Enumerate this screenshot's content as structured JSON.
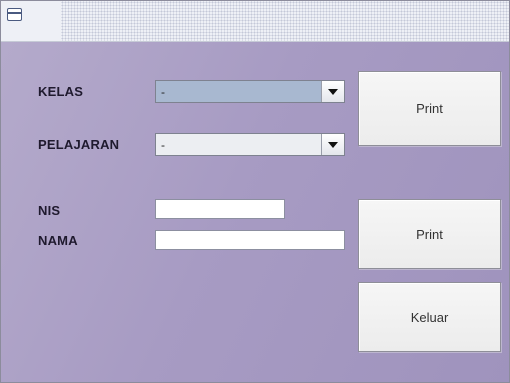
{
  "window": {
    "title": ""
  },
  "form": {
    "kelas_label": "KELAS",
    "kelas_value": "-",
    "pelajaran_label": "PELAJARAN",
    "pelajaran_value": "-",
    "nis_label": "NIS",
    "nis_value": "",
    "nama_label": "NAMA",
    "nama_value": ""
  },
  "buttons": {
    "print_class_label": "Print",
    "print_student_label": "Print",
    "exit_label": "Keluar"
  },
  "colors": {
    "background": "#a89cc0",
    "kelas_combo_bg": "#a8b8d0",
    "pelajaran_combo_bg": "#eceef2"
  },
  "icons": [
    "window-icon",
    "chevron-down-icon"
  ]
}
